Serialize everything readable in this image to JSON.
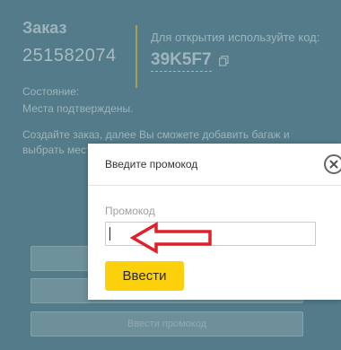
{
  "order": {
    "label": "Заказ",
    "number": "251582074",
    "open_hint": "Для открытия используйте код:",
    "code": "39K5F7"
  },
  "status": {
    "label": "Состояние:",
    "value": "Места подтверждены."
  },
  "create_note": "Создайте заказ, далее Вы сможете добавить багаж и выбрать мест",
  "background_buttons": {
    "promo_label": "Ввести промокод"
  },
  "modal": {
    "title": "Введите промокод",
    "field_label": "Промокод",
    "input_value": "",
    "submit_label": "Ввести"
  },
  "colors": {
    "accent_yellow": "#fcd10c",
    "input_border": "#f2d24a",
    "arrow_red": "#e0202a",
    "overlay": "#4e7482"
  },
  "icons": {
    "copy": "copy-icon",
    "close": "close-icon",
    "annotation": "red-arrow-icon"
  }
}
